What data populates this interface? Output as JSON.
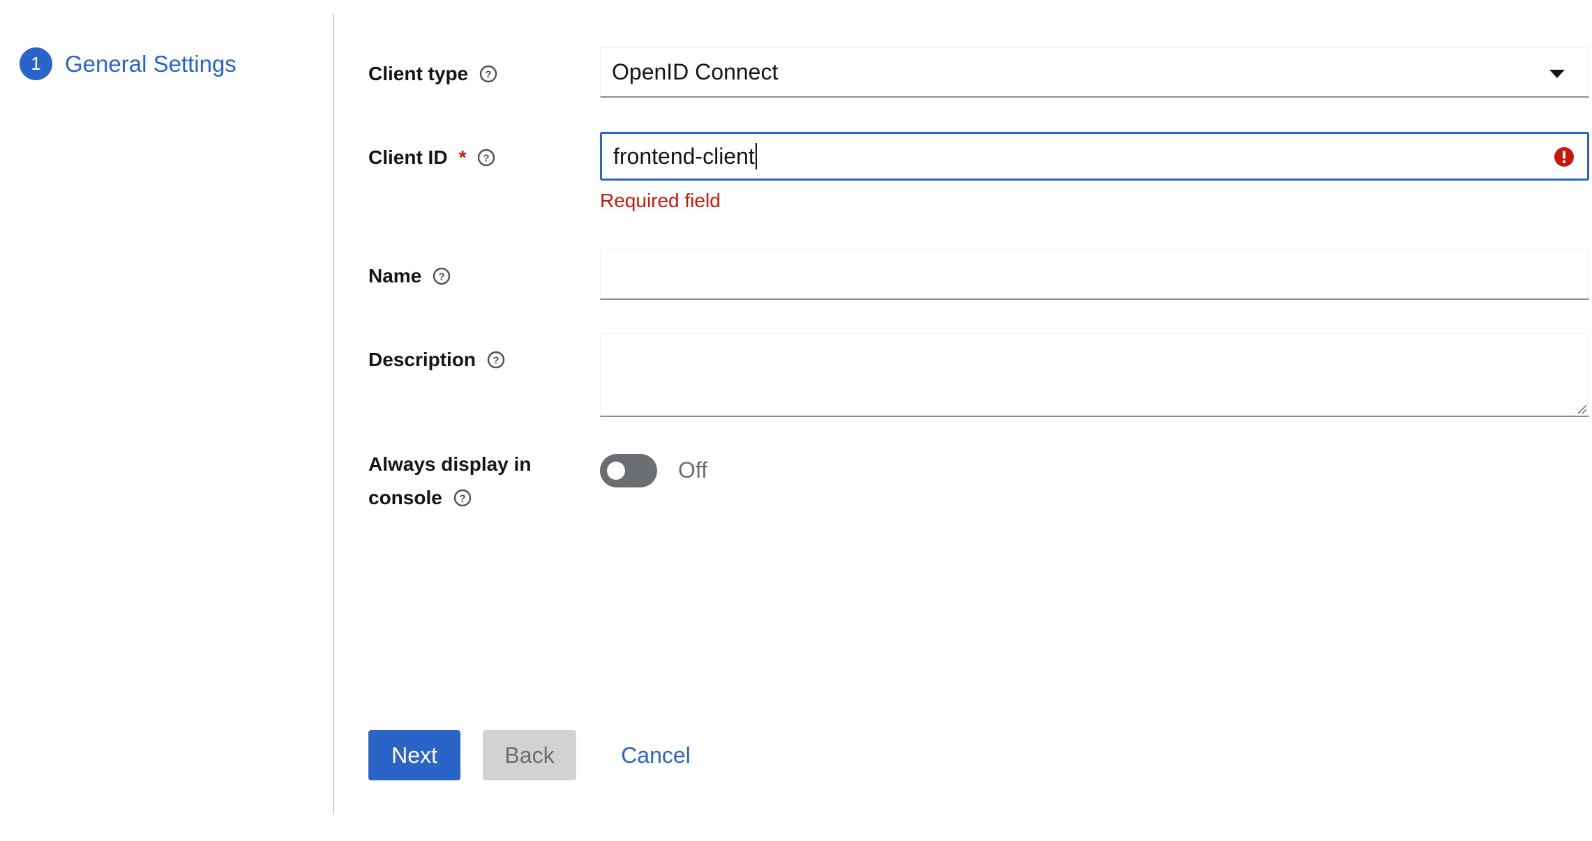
{
  "wizard_nav": {
    "steps": [
      {
        "number": "1",
        "label": "General Settings"
      }
    ]
  },
  "form": {
    "client_type": {
      "label": "Client type",
      "value": "OpenID Connect"
    },
    "client_id": {
      "label": "Client ID",
      "required_marker": "*",
      "value": "frontend-client",
      "error": "Required field"
    },
    "name": {
      "label": "Name",
      "value": ""
    },
    "description": {
      "label": "Description",
      "value": ""
    },
    "always_display": {
      "label_line1": "Always display in",
      "label_line2": "console",
      "state_text": "Off",
      "checked": false
    }
  },
  "footer": {
    "next_label": "Next",
    "back_label": "Back",
    "cancel_label": "Cancel"
  },
  "colors": {
    "primary": "#2a64c8",
    "error": "#c9190b",
    "disabled_bg": "#d2d2d2",
    "toggle_off": "#6a6e73"
  },
  "icons": {
    "help": "help-icon",
    "error": "exclamation-circle-icon",
    "select_caret": "caret-down-icon"
  }
}
